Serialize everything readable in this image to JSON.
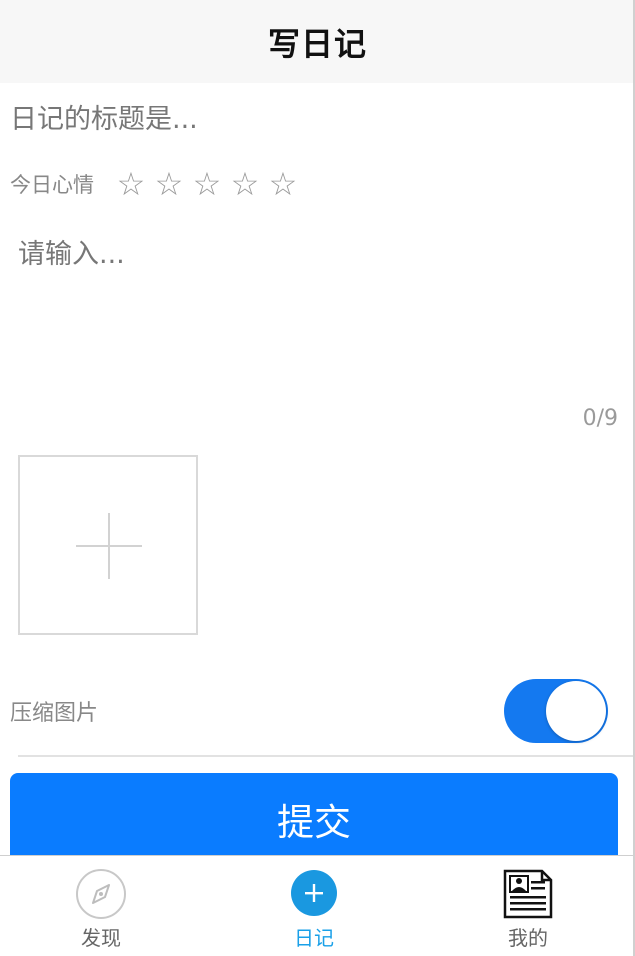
{
  "header": {
    "title": "写日记"
  },
  "form": {
    "title_placeholder": "日记的标题是...",
    "mood_label": "今日心情",
    "stars": [
      "☆",
      "☆",
      "☆",
      "☆",
      "☆"
    ],
    "content_placeholder": "请输入...",
    "image_count": "0/9",
    "compress_label": "压缩图片",
    "compress_enabled": true,
    "submit_label": "提交"
  },
  "tabbar": {
    "items": [
      {
        "label": "发现",
        "icon": "compass-icon",
        "active": false
      },
      {
        "label": "日记",
        "icon": "add-circle-icon",
        "active": true
      },
      {
        "label": "我的",
        "icon": "profile-card-icon",
        "active": false
      }
    ]
  },
  "colors": {
    "accent": "#0a7cff",
    "toggle_on": "#1479f0",
    "tab_active": "#1aa0e8",
    "header_bg": "#f7f7f7"
  }
}
